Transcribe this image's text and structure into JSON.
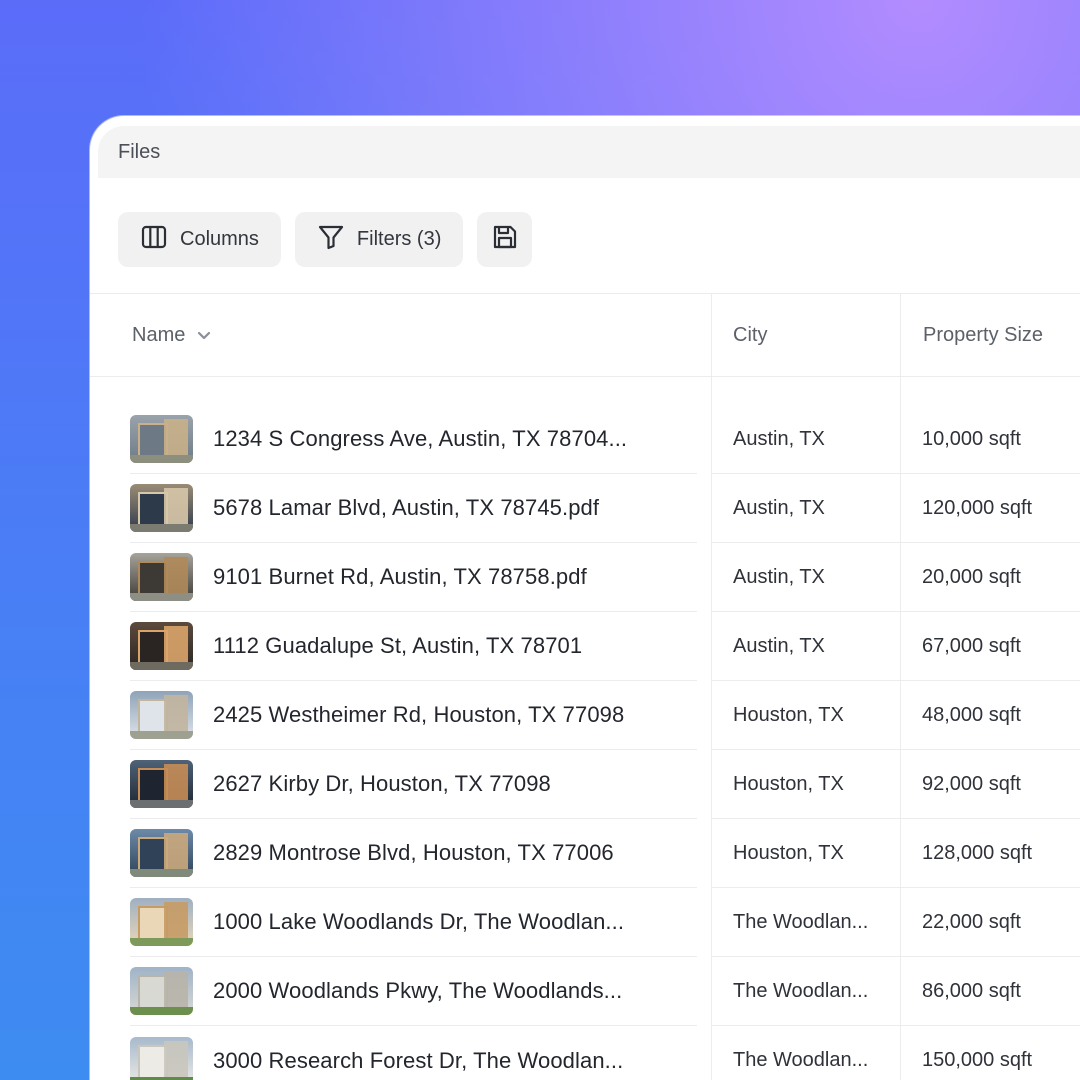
{
  "window": {
    "title": "Files"
  },
  "toolbar": {
    "columns_label": "Columns",
    "filters_label": "Filters (3)",
    "save_icon": "save-icon"
  },
  "table": {
    "headers": {
      "name": "Name",
      "city": "City",
      "size": "Property Size"
    },
    "rows": [
      {
        "name": "1234 S Congress Ave, Austin, TX 78704...",
        "city": "Austin, TX",
        "size": "10,000 sqft"
      },
      {
        "name": "5678 Lamar Blvd, Austin, TX 78745.pdf",
        "city": "Austin, TX",
        "size": "120,000 sqft"
      },
      {
        "name": "9101 Burnet Rd, Austin, TX 78758.pdf",
        "city": "Austin, TX",
        "size": "20,000 sqft"
      },
      {
        "name": "1112 Guadalupe St, Austin, TX 78701",
        "city": "Austin, TX",
        "size": "67,000 sqft"
      },
      {
        "name": "2425 Westheimer Rd, Houston, TX 77098",
        "city": "Houston, TX",
        "size": "48,000 sqft"
      },
      {
        "name": "2627 Kirby Dr, Houston, TX 77098",
        "city": "Houston, TX",
        "size": "92,000 sqft"
      },
      {
        "name": "2829 Montrose Blvd, Houston, TX 77006",
        "city": "Houston, TX",
        "size": "128,000 sqft"
      },
      {
        "name": "1000 Lake Woodlands Dr, The Woodlan...",
        "city": "The Woodlan...",
        "size": "22,000 sqft"
      },
      {
        "name": "2000 Woodlands Pkwy, The Woodlands...",
        "city": "The Woodlan...",
        "size": "86,000 sqft"
      },
      {
        "name": "3000 Research Forest Dr, The Woodlan...",
        "city": "The Woodlan...",
        "size": "150,000 sqft"
      }
    ]
  },
  "colors": {
    "background_top": "#ad88fb",
    "background_bottom": "#3d8cf1",
    "panel": "#ffffff",
    "button_bg": "#f1f1f2",
    "divider": "#ececee",
    "text_primary": "#23262d",
    "text_secondary": "#5c6068"
  }
}
